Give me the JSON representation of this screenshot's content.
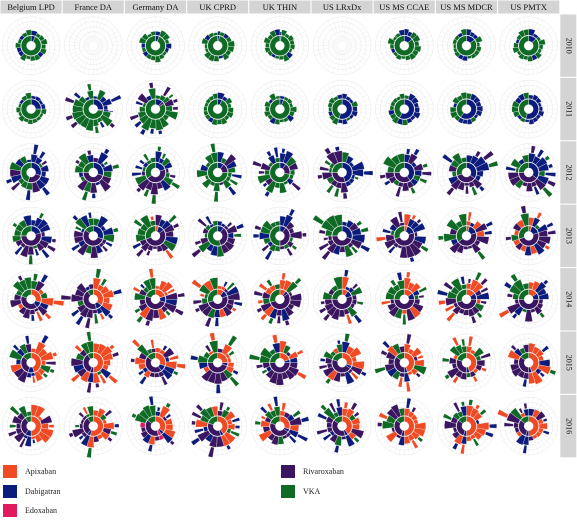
{
  "chart_data": {
    "type": "sunburst-grid",
    "columns": [
      "Belgium LPD",
      "France DA",
      "Germany DA",
      "UK CPRD",
      "UK THIN",
      "US LRxDx",
      "US MS CCAE",
      "US MS MDCR",
      "US PMTX"
    ],
    "rows": [
      "2010",
      "2011",
      "2012",
      "2013",
      "2014",
      "2015",
      "2016"
    ],
    "treatments": [
      {
        "name": "Apixaban",
        "color": "#ef4a23"
      },
      {
        "name": "Dabigatran",
        "color": "#0c1c7c"
      },
      {
        "name": "Edoxaban",
        "color": "#e2195f"
      },
      {
        "name": "Rivaroxaban",
        "color": "#3a1560"
      },
      {
        "name": "VKA",
        "color": "#0e6a24"
      }
    ],
    "inner_ring_shares": {
      "2010": [
        {
          "VKA": 0.93,
          "Dabigatran": 0.07
        },
        {},
        {
          "VKA": 0.94,
          "Dabigatran": 0.06
        },
        {
          "VKA": 0.97,
          "Dabigatran": 0.03
        },
        {
          "VKA": 0.98,
          "Dabigatran": 0.02
        },
        {},
        {
          "VKA": 0.86,
          "Dabigatran": 0.14
        },
        {
          "VKA": 0.85,
          "Dabigatran": 0.15
        },
        {
          "VKA": 0.87,
          "Dabigatran": 0.13
        }
      ],
      "2011": [
        {
          "VKA": 0.75,
          "Dabigatran": 0.25
        },
        {
          "VKA": 0.72,
          "Dabigatran": 0.26,
          "Rivaroxaban": 0.02
        },
        {
          "VKA": 0.84,
          "Dabigatran": 0.12,
          "Rivaroxaban": 0.04
        },
        {
          "VKA": 0.93,
          "Dabigatran": 0.07
        },
        {
          "VKA": 0.94,
          "Dabigatran": 0.06
        },
        {
          "Dabigatran": 0.55,
          "VKA": 0.45
        },
        {
          "Dabigatran": 0.58,
          "VKA": 0.42
        },
        {
          "Dabigatran": 0.6,
          "VKA": 0.4
        },
        {
          "Dabigatran": 0.55,
          "VKA": 0.45
        }
      ],
      "2012": [
        {
          "VKA": 0.45,
          "Dabigatran": 0.3,
          "Rivaroxaban": 0.25
        },
        {
          "Rivaroxaban": 0.45,
          "Dabigatran": 0.3,
          "VKA": 0.25
        },
        {
          "Rivaroxaban": 0.45,
          "VKA": 0.35,
          "Dabigatran": 0.2
        },
        {
          "VKA": 0.75,
          "Rivaroxaban": 0.15,
          "Dabigatran": 0.1
        },
        {
          "VKA": 0.72,
          "Rivaroxaban": 0.18,
          "Dabigatran": 0.1
        },
        {
          "Dabigatran": 0.45,
          "Rivaroxaban": 0.3,
          "VKA": 0.25
        },
        {
          "Dabigatran": 0.4,
          "Rivaroxaban": 0.35,
          "VKA": 0.25
        },
        {
          "Dabigatran": 0.35,
          "Rivaroxaban": 0.35,
          "VKA": 0.3
        },
        {
          "Dabigatran": 0.35,
          "Rivaroxaban": 0.4,
          "VKA": 0.25
        }
      ],
      "2013": [
        {
          "Rivaroxaban": 0.55,
          "VKA": 0.25,
          "Dabigatran": 0.2
        },
        {
          "Rivaroxaban": 0.55,
          "Dabigatran": 0.3,
          "VKA": 0.15
        },
        {
          "Rivaroxaban": 0.55,
          "VKA": 0.3,
          "Dabigatran": 0.1,
          "Apixaban": 0.05
        },
        {
          "VKA": 0.55,
          "Rivaroxaban": 0.35,
          "Dabigatran": 0.1
        },
        {
          "VKA": 0.5,
          "Rivaroxaban": 0.4,
          "Dabigatran": 0.1
        },
        {
          "Rivaroxaban": 0.45,
          "Dabigatran": 0.3,
          "VKA": 0.25
        },
        {
          "Rivaroxaban": 0.5,
          "VKA": 0.3,
          "Dabigatran": 0.15,
          "Apixaban": 0.05
        },
        {
          "Rivaroxaban": 0.45,
          "VKA": 0.35,
          "Dabigatran": 0.15,
          "Apixaban": 0.05
        },
        {
          "Rivaroxaban": 0.5,
          "VKA": 0.3,
          "Dabigatran": 0.15,
          "Apixaban": 0.05
        }
      ],
      "2014": [
        {
          "Apixaban": 0.3,
          "Rivaroxaban": 0.4,
          "VKA": 0.2,
          "Dabigatran": 0.1
        },
        {
          "Apixaban": 0.35,
          "Rivaroxaban": 0.45,
          "VKA": 0.1,
          "Dabigatran": 0.1
        },
        {
          "Rivaroxaban": 0.5,
          "Apixaban": 0.2,
          "VKA": 0.2,
          "Dabigatran": 0.1
        },
        {
          "Rivaroxaban": 0.5,
          "VKA": 0.3,
          "Apixaban": 0.1,
          "Dabigatran": 0.1
        },
        {
          "Rivaroxaban": 0.55,
          "VKA": 0.3,
          "Apixaban": 0.1,
          "Dabigatran": 0.05
        },
        {
          "Rivaroxaban": 0.55,
          "VKA": 0.25,
          "Apixaban": 0.1,
          "Dabigatran": 0.1
        },
        {
          "Rivaroxaban": 0.5,
          "VKA": 0.25,
          "Apixaban": 0.15,
          "Dabigatran": 0.1
        },
        {
          "Rivaroxaban": 0.45,
          "VKA": 0.3,
          "Apixaban": 0.15,
          "Dabigatran": 0.1
        },
        {
          "Rivaroxaban": 0.5,
          "VKA": 0.25,
          "Apixaban": 0.15,
          "Dabigatran": 0.1
        }
      ],
      "2015": [
        {
          "Apixaban": 0.45,
          "Rivaroxaban": 0.3,
          "VKA": 0.15,
          "Dabigatran": 0.1
        },
        {
          "Apixaban": 0.5,
          "Rivaroxaban": 0.35,
          "VKA": 0.1,
          "Dabigatran": 0.05
        },
        {
          "Rivaroxaban": 0.45,
          "Apixaban": 0.3,
          "VKA": 0.15,
          "Dabigatran": 0.1
        },
        {
          "Rivaroxaban": 0.45,
          "VKA": 0.25,
          "Apixaban": 0.25,
          "Dabigatran": 0.05
        },
        {
          "Rivaroxaban": 0.5,
          "VKA": 0.25,
          "Apixaban": 0.2,
          "Dabigatran": 0.05
        },
        {
          "Rivaroxaban": 0.45,
          "Apixaban": 0.3,
          "VKA": 0.2,
          "Dabigatran": 0.05
        },
        {
          "Apixaban": 0.45,
          "Rivaroxaban": 0.35,
          "VKA": 0.15,
          "Dabigatran": 0.05
        },
        {
          "Apixaban": 0.45,
          "Rivaroxaban": 0.3,
          "VKA": 0.2,
          "Dabigatran": 0.05
        },
        {
          "Apixaban": 0.45,
          "Rivaroxaban": 0.35,
          "VKA": 0.15,
          "Dabigatran": 0.05
        }
      ],
      "2016": [
        {
          "Apixaban": 0.5,
          "Rivaroxaban": 0.3,
          "VKA": 0.1,
          "Dabigatran": 0.1
        },
        {
          "Apixaban": 0.55,
          "Rivaroxaban": 0.3,
          "VKA": 0.1,
          "Dabigatran": 0.05
        },
        {
          "Rivaroxaban": 0.4,
          "Apixaban": 0.35,
          "VKA": 0.15,
          "Dabigatran": 0.05,
          "Edoxaban": 0.05
        },
        {
          "Apixaban": 0.4,
          "Rivaroxaban": 0.35,
          "VKA": 0.2,
          "Dabigatran": 0.05
        },
        {
          "Rivaroxaban": 0.45,
          "Apixaban": 0.3,
          "VKA": 0.2,
          "Dabigatran": 0.05
        },
        {
          "Rivaroxaban": 0.4,
          "Apixaban": 0.4,
          "VKA": 0.15,
          "Dabigatran": 0.05
        },
        {
          "Apixaban": 0.5,
          "Rivaroxaban": 0.3,
          "VKA": 0.15,
          "Dabigatran": 0.05
        },
        {
          "Apixaban": 0.5,
          "Rivaroxaban": 0.3,
          "VKA": 0.15,
          "Dabigatran": 0.05
        },
        {
          "Apixaban": 0.5,
          "Rivaroxaban": 0.3,
          "VKA": 0.15,
          "Dabigatran": 0.05
        }
      ]
    },
    "legend_placement": "bottom"
  },
  "legend": {
    "items": [
      {
        "label": "Apixaban",
        "color": "#ef4a23"
      },
      {
        "label": "Dabigatran",
        "color": "#0c1c7c"
      },
      {
        "label": "Edoxaban",
        "color": "#e2195f"
      },
      {
        "label": "Rivaroxaban",
        "color": "#3a1560"
      },
      {
        "label": "VKA",
        "color": "#0e6a24"
      }
    ]
  }
}
